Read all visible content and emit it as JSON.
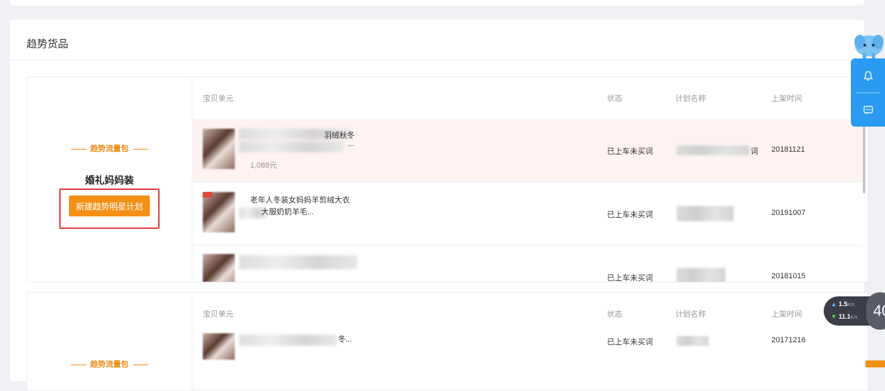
{
  "section": {
    "title": "趋势货品"
  },
  "table": {
    "headers": {
      "item": "宝贝单元",
      "status": "状态",
      "plan": "计划名称",
      "date": "上架时间"
    }
  },
  "cards": [
    {
      "package_label": "趋势流量包",
      "package_name": "婚礼妈妈装",
      "button_label": "新建趋势明星计划",
      "rows": [
        {
          "title_line1": "羽绒秋冬",
          "title_line2": "...",
          "price": "1,088元",
          "status": "已上车未买词",
          "plan_suffix": "词",
          "date": "20181121"
        },
        {
          "title_line1": "老年人冬装女妈妈羊剪绒大衣",
          "title_line2": "大服奶奶羊毛...",
          "status": "已上车未买词",
          "date": "20191007"
        },
        {
          "status": "已上车未买词",
          "date": "20181015"
        }
      ]
    },
    {
      "package_label": "趋势流量包",
      "rows": [
        {
          "title_line1": "冬...",
          "status": "已上车未买词",
          "date": "20171216"
        }
      ]
    }
  ],
  "widgets": {
    "notify_icon": "bell-icon",
    "chat_icon": "chat-icon",
    "net_up": "1.5",
    "net_up_unit": "K/s",
    "net_down": "11.1",
    "net_down_unit": "K/s",
    "net_badge": "40"
  },
  "colors": {
    "accent": "#f39016",
    "highlight_row": "#fdf3f0",
    "float_blue": "#2a9bf0",
    "annotation_red": "#e53b3b"
  }
}
